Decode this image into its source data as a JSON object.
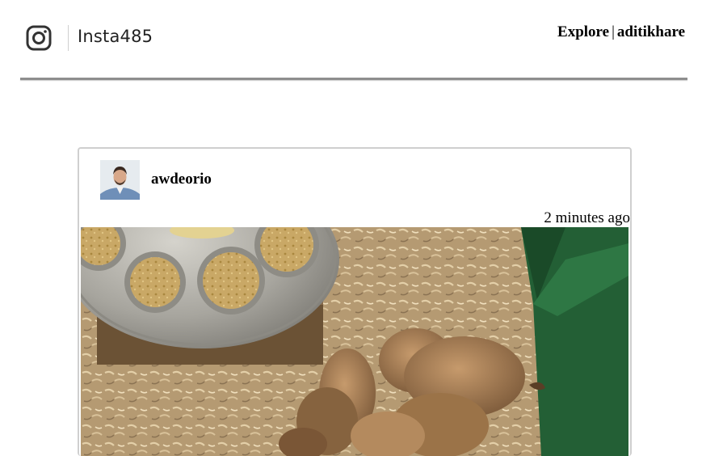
{
  "header": {
    "brand": "Insta485",
    "nav_explore": "Explore",
    "nav_separator": "|",
    "nav_user": "aditikhare",
    "logo_icon": "instagram-logo-icon"
  },
  "post": {
    "owner": "awdeorio",
    "timestamp": "2 minutes ago",
    "avatar_icon": "user-avatar",
    "image_description_icon": "post-image"
  }
}
